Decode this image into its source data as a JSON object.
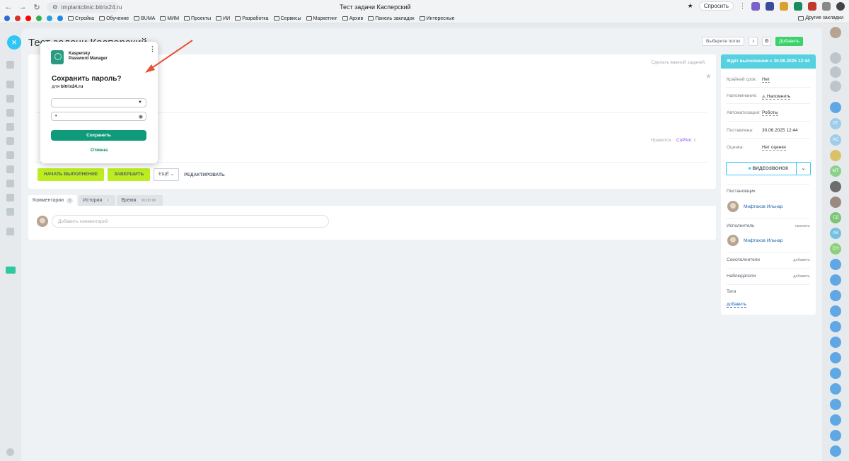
{
  "browser": {
    "url": "implantclinic.bitrix24.ru",
    "tab_title": "Тест задачи Касперский",
    "ask_label": "Спросить"
  },
  "bookmarks": {
    "items": [
      "Стройка",
      "Обучение",
      "BUMA",
      "МИМ",
      "Проекты",
      "ИИ",
      "Разработка",
      "Сервисы",
      "Маркетинг",
      "Архив",
      "Панель закладок",
      "Интересные"
    ],
    "other": "Другие закладки"
  },
  "task": {
    "title": "Тест задачи Касперский",
    "flow_select": "Выберите поток",
    "add_button": "Добавить",
    "make_urgent": "Сделать важной задачей",
    "like_label": "Нравится",
    "copilot_label": "CoPilot",
    "like_count": "1",
    "start_button": "Начать выполнение",
    "finish_button": "Завершить",
    "more_button": "Ещё",
    "edit_button": "Редактировать"
  },
  "tabs": [
    {
      "label": "Комментарии",
      "count": "0"
    },
    {
      "label": "История",
      "count": "1"
    },
    {
      "label": "Время",
      "count": "00:00:00"
    }
  ],
  "comment": {
    "placeholder": "Добавить комментарий"
  },
  "sidebar": {
    "status": "Ждёт выполнения с 30.06.2025 12:44",
    "deadline_label": "Крайний срок:",
    "deadline_value": "Нет",
    "reminder_label": "Напоминание:",
    "reminder_value": "Напомнить",
    "automation_label": "Автоматизация:",
    "automation_value": "Роботы",
    "created_label": "Поставлена:",
    "created_value": "30.06.2025 12:44",
    "rating_label": "Оценка:",
    "rating_value": "Нет оценки",
    "videocall": "Видеозвонок",
    "creator_head": "Постановщик",
    "creator_name": "Мифтахов Ильнар",
    "assignee_head": "Исполнитель",
    "assignee_change": "сменить",
    "assignee_name": "Мифтахов Ильнар",
    "coexec_head": "Соисполнители",
    "coexec_add": "добавить",
    "observers_head": "Наблюдатели",
    "observers_add": "добавить",
    "tags_head": "Теги",
    "tags_add": "добавить"
  },
  "right_avatars": [
    "РТ",
    "АС",
    "МТ",
    "СД",
    "АК",
    "СН"
  ],
  "kpm": {
    "brand_line1": "Kaspersky",
    "brand_line2": "Password Manager",
    "question": "Сохранить пароль?",
    "for_prefix": "для",
    "site": "bitrix24.ru",
    "password_mask": "•",
    "save": "Сохранить",
    "cancel": "Отмена"
  },
  "colors": {
    "accent_green": "#bbed21",
    "kpm_green": "#0f9a7a",
    "status_bar": "#56d1e0",
    "arrow": "#e8503a"
  }
}
